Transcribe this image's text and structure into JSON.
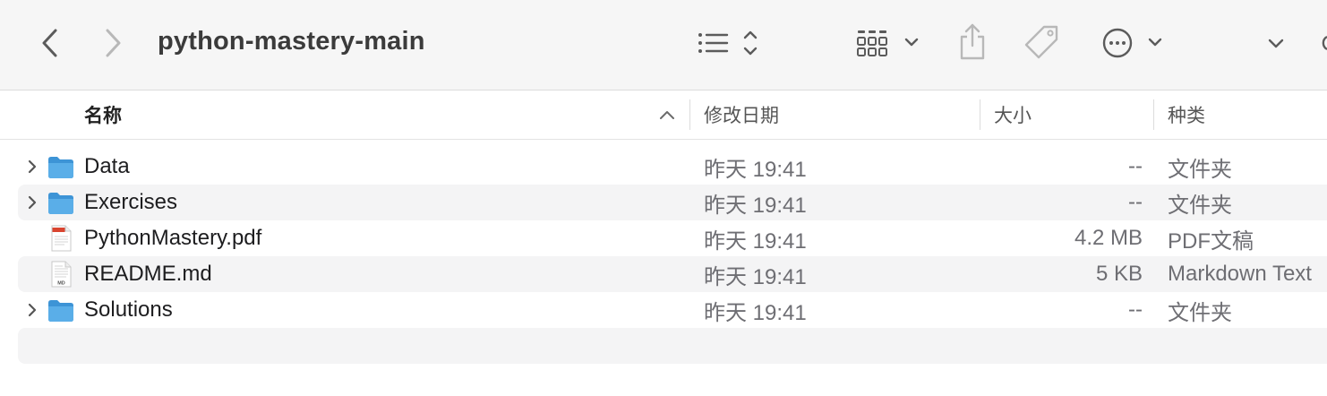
{
  "toolbar": {
    "title": "python-mastery-main",
    "icons": {
      "back": "chevron-left-icon",
      "forward": "chevron-right-icon",
      "list_view": "list-view-icon",
      "grid_view": "grid-view-icon",
      "share": "share-icon",
      "tag": "tag-icon",
      "more": "ellipsis-circle-icon",
      "expand": "chevron-down-icon"
    }
  },
  "columns": {
    "name": "名称",
    "date": "修改日期",
    "size": "大小",
    "kind": "种类",
    "sort_direction": "ascending"
  },
  "files": [
    {
      "name": "Data",
      "date": "昨天 19:41",
      "size": "--",
      "kind": "文件夹",
      "type": "folder"
    },
    {
      "name": "Exercises",
      "date": "昨天 19:41",
      "size": "--",
      "kind": "文件夹",
      "type": "folder"
    },
    {
      "name": "PythonMastery.pdf",
      "date": "昨天 19:41",
      "size": "4.2 MB",
      "kind": "PDF文稿",
      "type": "pdf"
    },
    {
      "name": "README.md",
      "date": "昨天 19:41",
      "size": "5 KB",
      "kind": "Markdown Text",
      "type": "markdown"
    },
    {
      "name": "Solutions",
      "date": "昨天 19:41",
      "size": "--",
      "kind": "文件夹",
      "type": "folder"
    }
  ],
  "colors": {
    "folder": "#5aaee8",
    "folder_dark": "#3d94d6",
    "toolbar_bg": "#f6f6f6",
    "row_alt": "#f4f4f5",
    "icon_gray": "#6b6b6b",
    "icon_disabled": "#b8b8b8"
  }
}
